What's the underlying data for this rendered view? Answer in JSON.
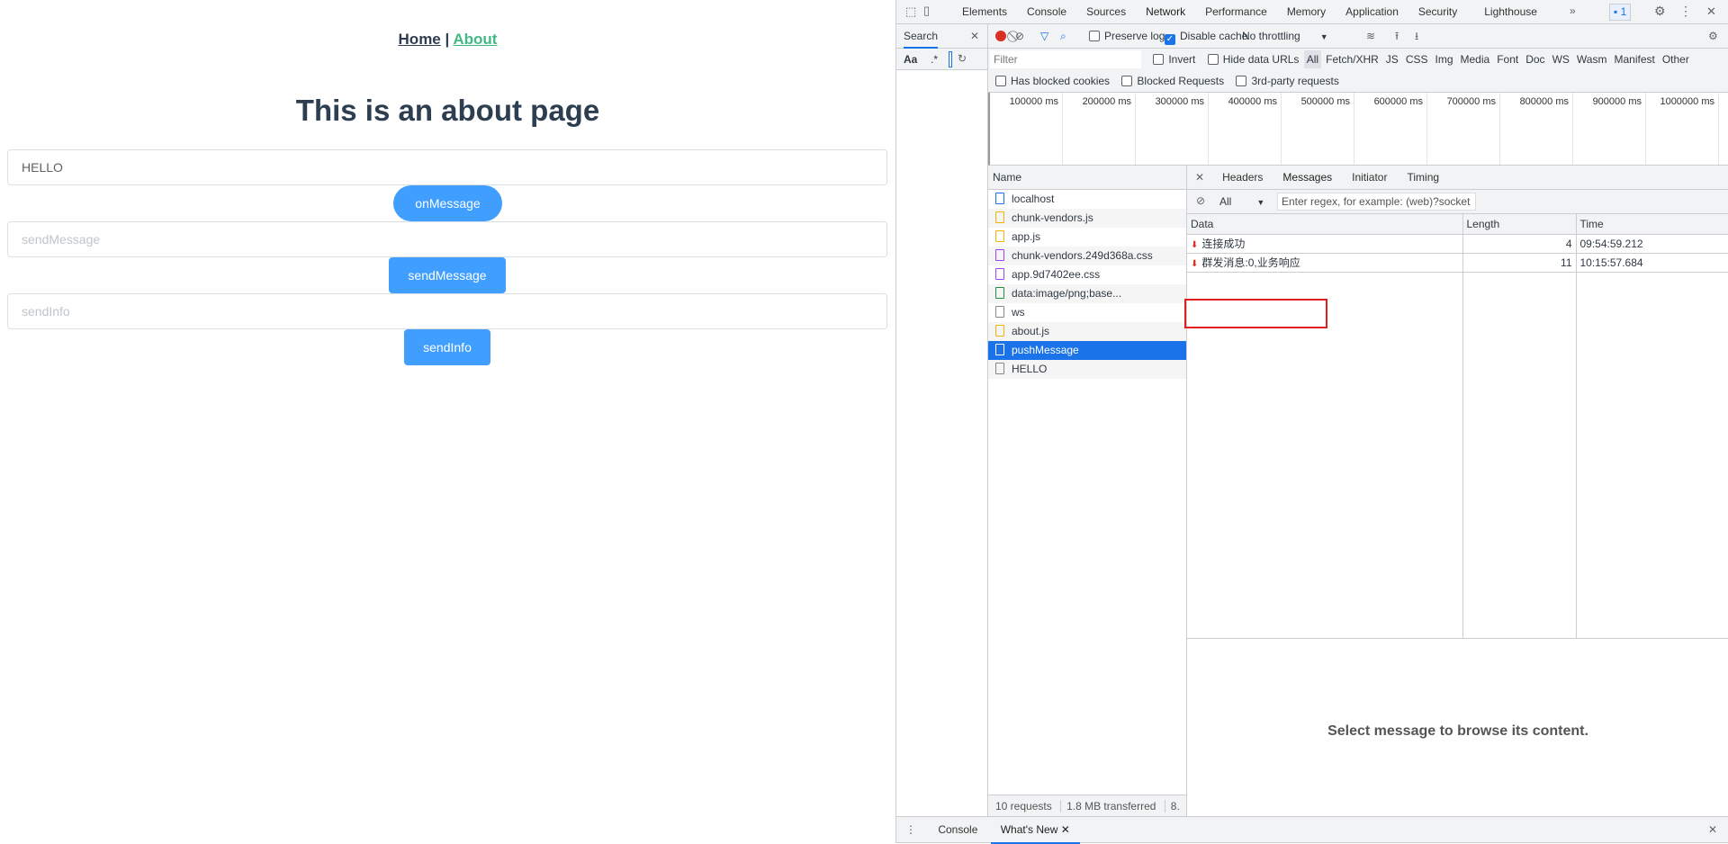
{
  "page": {
    "nav": {
      "home": "Home",
      "sep": "|",
      "about": "About"
    },
    "title": "This is an about page",
    "inputs": [
      {
        "value": "HELLO",
        "placeholder": ""
      },
      {
        "value": "",
        "placeholder": "sendMessage"
      },
      {
        "value": "",
        "placeholder": "sendInfo"
      }
    ],
    "buttons": [
      "onMessage",
      "sendMessage",
      "sendInfo"
    ],
    "colors": {
      "primary": "#409eff",
      "active_link": "#42b983"
    }
  },
  "devtools": {
    "tabs": [
      "Elements",
      "Console",
      "Sources",
      "Network",
      "Performance",
      "Memory",
      "Application",
      "Security",
      "Lighthouse"
    ],
    "active_tab": "Network",
    "more": "»",
    "issues_badge": "1",
    "search": {
      "label": "Search",
      "close": "✕",
      "aa": "Aa",
      "regex": ".*"
    },
    "toolbar": {
      "preserve_log": "Preserve log",
      "preserve_log_checked": false,
      "disable_cache": "Disable cache",
      "disable_cache_checked": true,
      "throttling": "No throttling"
    },
    "filter": {
      "placeholder": "Filter",
      "invert": "Invert",
      "hide_data_urls": "Hide data URLs",
      "types": [
        "All",
        "Fetch/XHR",
        "JS",
        "CSS",
        "Img",
        "Media",
        "Font",
        "Doc",
        "WS",
        "Wasm",
        "Manifest",
        "Other"
      ],
      "active_type": "All",
      "has_blocked_cookies": "Has blocked cookies",
      "blocked_requests": "Blocked Requests",
      "third_party": "3rd-party requests"
    },
    "timeline": [
      "100000 ms",
      "200000 ms",
      "300000 ms",
      "400000 ms",
      "500000 ms",
      "600000 ms",
      "700000 ms",
      "800000 ms",
      "900000 ms",
      "1000000 ms"
    ],
    "name_header": "Name",
    "requests": [
      {
        "name": "localhost",
        "icon": "document-icon",
        "color": "#1a73e8"
      },
      {
        "name": "chunk-vendors.js",
        "icon": "script-icon",
        "color": "#f5b400"
      },
      {
        "name": "app.js",
        "icon": "script-icon",
        "color": "#f5b400"
      },
      {
        "name": "chunk-vendors.249d368a.css",
        "icon": "stylesheet-icon",
        "color": "#a142f4"
      },
      {
        "name": "app.9d7402ee.css",
        "icon": "stylesheet-icon",
        "color": "#a142f4"
      },
      {
        "name": "data:image/png;base...",
        "icon": "image-icon",
        "color": "#1e8e3e"
      },
      {
        "name": "ws",
        "icon": "websocket-icon",
        "color": "#888888"
      },
      {
        "name": "about.js",
        "icon": "script-icon",
        "color": "#f5b400"
      },
      {
        "name": "pushMessage",
        "icon": "websocket-icon",
        "color": "#ffffff",
        "selected": true
      },
      {
        "name": "HELLO",
        "icon": "websocket-icon",
        "color": "#888888"
      }
    ],
    "detail_tabs": [
      "Headers",
      "Messages",
      "Initiator",
      "Timing"
    ],
    "active_detail_tab": "Messages",
    "messages_filter": {
      "type": "All",
      "placeholder": "Enter regex, for example: (web)?socket"
    },
    "messages_columns": [
      "Data",
      "Length",
      "Time"
    ],
    "messages": [
      {
        "data": "连接成功",
        "length": "4",
        "time": "09:54:59.212"
      },
      {
        "data": "群发消息:0,业务响应",
        "length": "11",
        "time": "10:15:57.684",
        "highlighted": true
      }
    ],
    "empty_message": "Select message to browse its content.",
    "status": {
      "requests": "10 requests",
      "transferred": "1.8 MB transferred",
      "more": "8."
    },
    "drawer": {
      "tabs": [
        "Console",
        "What's New"
      ],
      "active": "What's New",
      "close": "✕"
    }
  }
}
